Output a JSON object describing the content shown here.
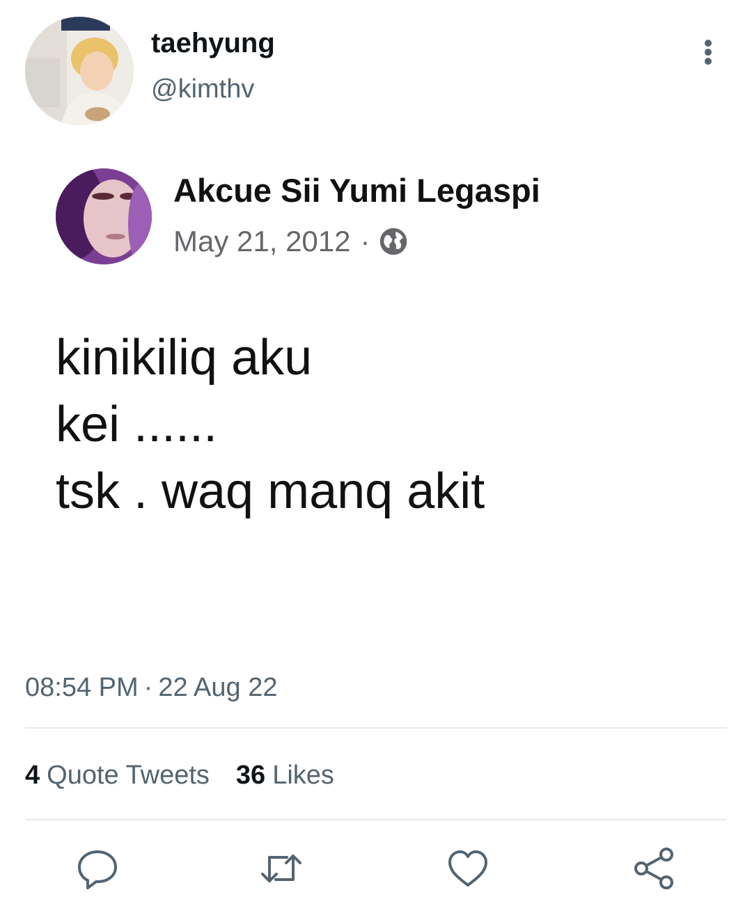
{
  "tweet": {
    "author": {
      "display_name": "taehyung",
      "handle": "@kimthv"
    },
    "timestamp": {
      "time": "08:54 PM",
      "separator": "·",
      "date": "22 Aug 22"
    },
    "stats": {
      "quote_tweets": {
        "count": "4",
        "label": "Quote Tweets"
      },
      "likes": {
        "count": "36",
        "label": "Likes"
      }
    },
    "icons": {
      "more": "more-vertical-icon",
      "reply": "reply-icon",
      "retweet": "retweet-icon",
      "like": "heart-icon",
      "share": "share-icon",
      "audience": "globe-icon"
    }
  },
  "embedded_post": {
    "name": "Akcue Sii Yumi Legaspi",
    "date": "May 21, 2012",
    "separator": "·",
    "lines": [
      "kinikiliq aku",
      "kei ......",
      "tsk . waq manq akit"
    ]
  },
  "colors": {
    "primary_text": "#0f1419",
    "secondary_text": "#536471",
    "divider": "#e6e9eb"
  }
}
